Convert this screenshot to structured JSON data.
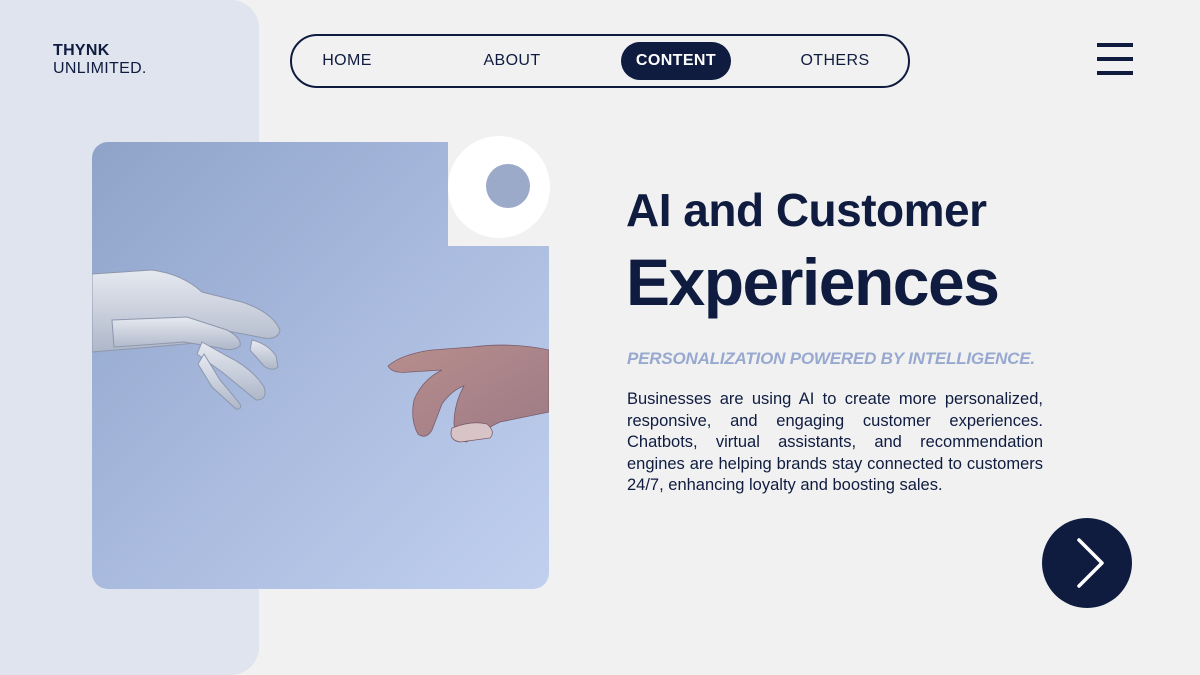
{
  "brand": {
    "line1": "THYNK",
    "line2": "UNLIMITED."
  },
  "nav": {
    "items": [
      {
        "label": "HOME"
      },
      {
        "label": "ABOUT"
      },
      {
        "label": "CONTENT",
        "active": true
      },
      {
        "label": "OTHERS"
      }
    ]
  },
  "menu_icon": "hamburger-menu-icon",
  "hero": {
    "image_alt": "robot-hand-reaching-human-hand",
    "title_line1": "AI and Customer",
    "title_line2": "Experiences",
    "subtitle": "PERSONALIZATION POWERED BY INTELLIGENCE.",
    "body": "Businesses are using AI to create more personalized, responsive, and engaging customer experiences. Chatbots, virtual assistants, and recommendation engines are helping brands stay connected to customers 24/7, enhancing loyalty and boosting sales."
  },
  "next_icon": "chevron-right-icon",
  "colors": {
    "navy": "#0f1c40",
    "background": "#f1f1f1",
    "side_panel": "#dfe4ee",
    "accent_light_blue": "#98a9d0"
  }
}
